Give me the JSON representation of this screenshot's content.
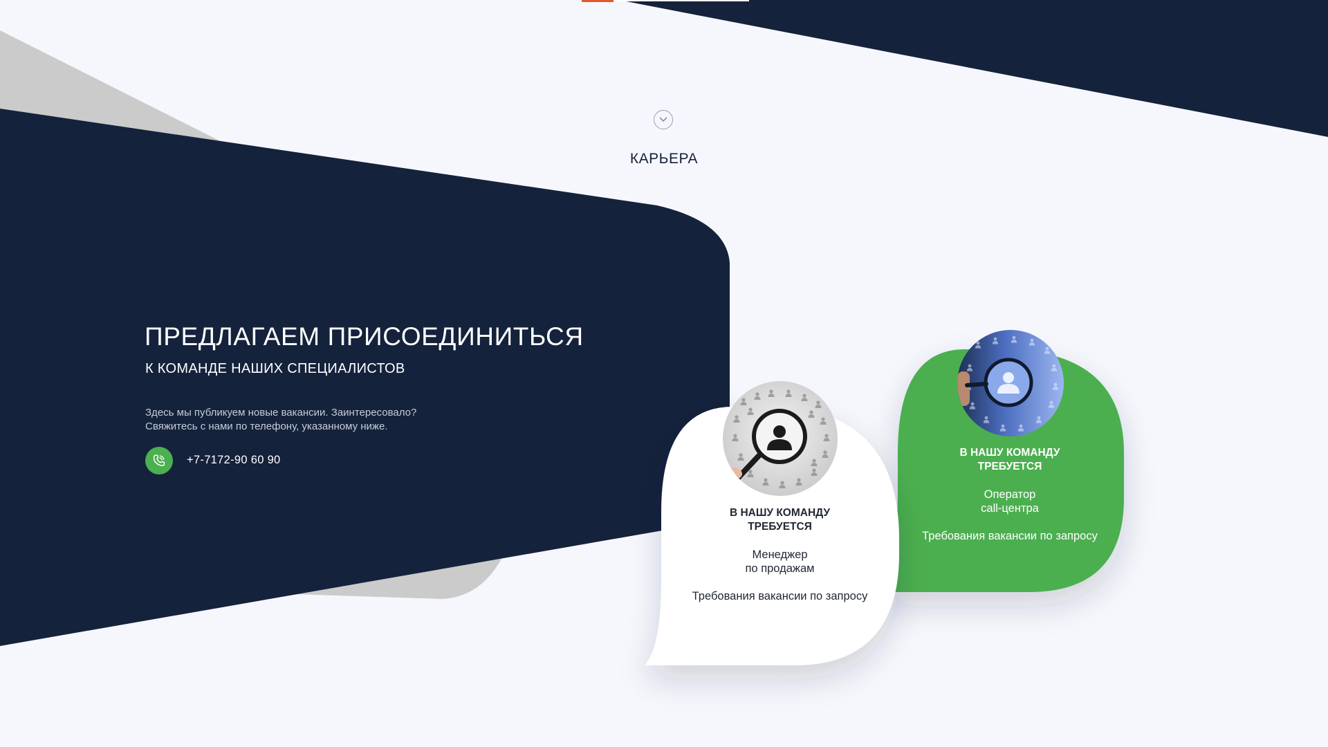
{
  "section": {
    "title": "КАРЬЕРА",
    "scroll_icon": "chevron-down-circle-icon"
  },
  "hero": {
    "title": "ПРЕДЛАГАЕМ ПРИСОЕДИНИТЬСЯ",
    "subtitle": "К КОМАНДЕ НАШИХ СПЕЦИАЛИСТОВ",
    "description_line1": "Здесь мы публикуем новые вакансии. Заинтересовало?",
    "description_line2": "Свяжитесь с нами по телефону, указанному ниже.",
    "phone_icon": "phone-call-icon",
    "phone": "+7-7172-90 60 90"
  },
  "vacancies": [
    {
      "heading_line1": "В НАШУ КОМАНДУ",
      "heading_line2": "ТРЕБУЕТСЯ",
      "role_line1": "Менеджер",
      "role_line2": "по продажам",
      "requirements": "Требования вакансии по запросу",
      "image": "magnifier-people-search-icon",
      "style": "white"
    },
    {
      "heading_line1": "В НАШУ КОМАНДУ",
      "heading_line2": "ТРЕБУЕТСЯ",
      "role_line1": "Оператор",
      "role_line2": "call-центра",
      "requirements": "Требования вакансии по запросу",
      "image": "magnifier-people-search-icon",
      "style": "green"
    }
  ],
  "colors": {
    "navy": "#15223c",
    "green": "#4caf50",
    "page_bg": "#f5f7fd",
    "accent_orange": "#e2572b",
    "gray_shape": "#cbcbcb"
  }
}
